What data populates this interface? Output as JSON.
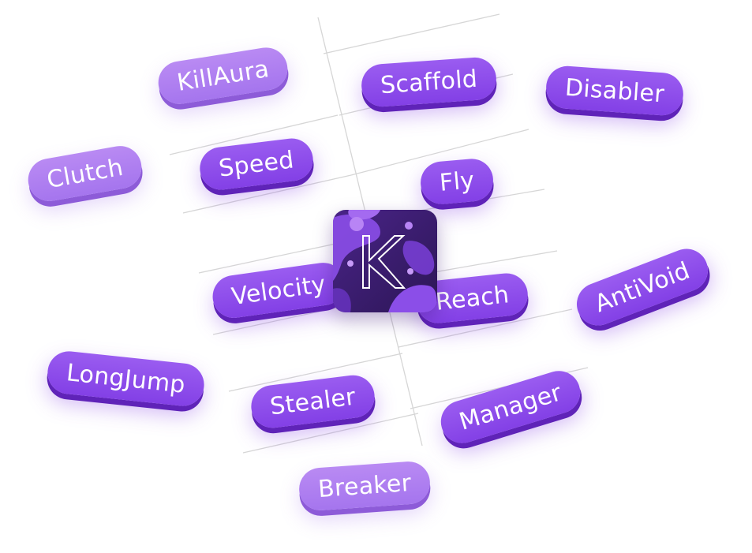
{
  "logo": {
    "letter": "K",
    "icon": "k-logo-icon",
    "colors": {
      "background": "#3b1d6e",
      "blob_primary": "#8b4ee8",
      "blob_secondary": "#a46af0",
      "letter_stroke": "#ffffff"
    }
  },
  "pills": [
    {
      "id": "killaura",
      "label": "KillAura",
      "style": "soft"
    },
    {
      "id": "scaffold",
      "label": "Scaffold",
      "style": "deep"
    },
    {
      "id": "disabler",
      "label": "Disabler",
      "style": "deep"
    },
    {
      "id": "clutch",
      "label": "Clutch",
      "style": "soft"
    },
    {
      "id": "speed",
      "label": "Speed",
      "style": "deep"
    },
    {
      "id": "fly",
      "label": "Fly",
      "style": "deep"
    },
    {
      "id": "velocity",
      "label": "Velocity",
      "style": "deep"
    },
    {
      "id": "reach",
      "label": "Reach",
      "style": "deep"
    },
    {
      "id": "antivoid",
      "label": "AntiVoid",
      "style": "deep"
    },
    {
      "id": "longjump",
      "label": "LongJump",
      "style": "deep"
    },
    {
      "id": "stealer",
      "label": "Stealer",
      "style": "deep"
    },
    {
      "id": "manager",
      "label": "Manager",
      "style": "deep"
    },
    {
      "id": "breaker",
      "label": "Breaker",
      "style": "soft"
    }
  ],
  "colors": {
    "pill_deep": "#8a47e8",
    "pill_soft": "#b083f0",
    "pill_text": "#ffffff",
    "grid_line": "#d9d9d9"
  }
}
